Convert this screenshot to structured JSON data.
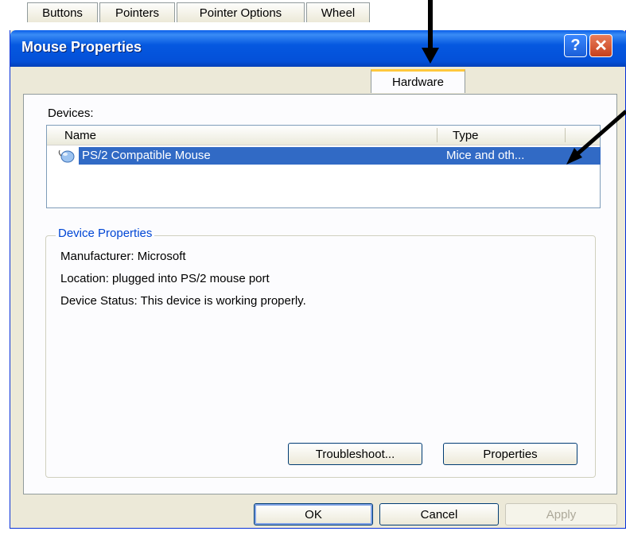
{
  "window": {
    "title": "Mouse Properties",
    "help_glyph": "?",
    "close_glyph": "✕"
  },
  "tabs": [
    {
      "label": "Buttons"
    },
    {
      "label": "Pointers"
    },
    {
      "label": "Pointer Options"
    },
    {
      "label": "Wheel"
    },
    {
      "label": "Hardware",
      "active": true
    }
  ],
  "hardware": {
    "devices_label": "Devices:",
    "columns": {
      "name": "Name",
      "type": "Type"
    },
    "devices": [
      {
        "name": "PS/2 Compatible Mouse",
        "type": "Mice and oth...",
        "selected": true
      }
    ],
    "device_properties": {
      "title": "Device Properties",
      "manufacturer": "Manufacturer: Microsoft",
      "location": "Location: plugged into PS/2 mouse port",
      "status": "Device Status: This device is working properly."
    },
    "troubleshoot_label": "Troubleshoot...",
    "properties_label": "Properties"
  },
  "footer": {
    "ok_label": "OK",
    "cancel_label": "Cancel",
    "apply_label": "Apply"
  },
  "colors": {
    "selection": "#316ac5",
    "group_title": "#0046d5",
    "active_tab_accent": "#ffc83c"
  }
}
